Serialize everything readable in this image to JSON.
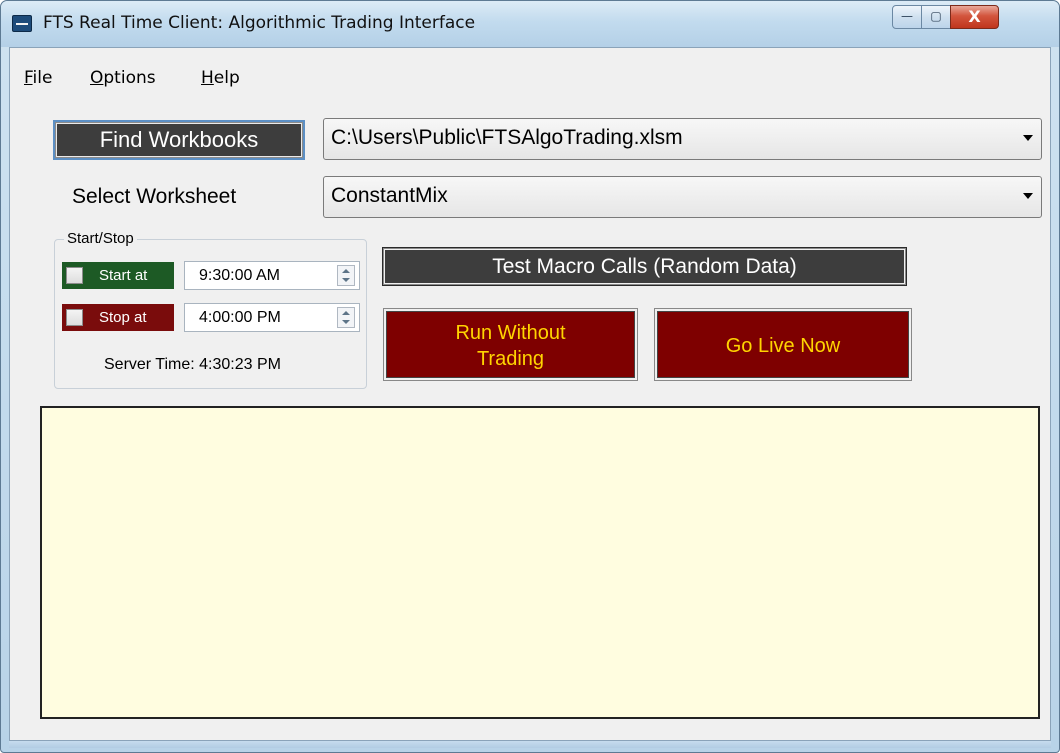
{
  "window": {
    "title": "FTS Real Time Client: Algorithmic Trading Interface",
    "controls": {
      "minimize": "—",
      "maximize": "▢",
      "close": "X"
    }
  },
  "menu": {
    "file": {
      "accel": "F",
      "rest": "ile"
    },
    "options": {
      "accel": "O",
      "rest": "ptions"
    },
    "help": {
      "accel": "H",
      "rest": "elp"
    }
  },
  "workbook": {
    "find_label": "Find Workbooks",
    "selected": "C:\\Users\\Public\\FTSAlgoTrading.xlsm"
  },
  "worksheet": {
    "label": "Select Worksheet",
    "selected": "ConstantMix"
  },
  "start_stop": {
    "caption": "Start/Stop",
    "start_label": "Start at",
    "start_checked": false,
    "start_time": "9:30:00 AM",
    "stop_label": "Stop at",
    "stop_checked": false,
    "stop_time": "4:00:00 PM",
    "server_time": "Server Time: 4:30:23 PM"
  },
  "actions": {
    "test_macro": "Test Macro Calls (Random Data)",
    "run_without_line1": "Run Without",
    "run_without_line2": "Trading",
    "go_live": "Go Live Now"
  },
  "colors": {
    "dark_button": "#3d3d3d",
    "red_button": "#7e0000",
    "button_text_yellow": "#ffd400",
    "start_green": "#1d5a25",
    "stop_red": "#7a0c0c",
    "log_background": "#fffde0"
  },
  "icons": {
    "app": "app-icon",
    "combo_arrow": "chevron-down-icon",
    "spin": "spin-updown-icon"
  }
}
